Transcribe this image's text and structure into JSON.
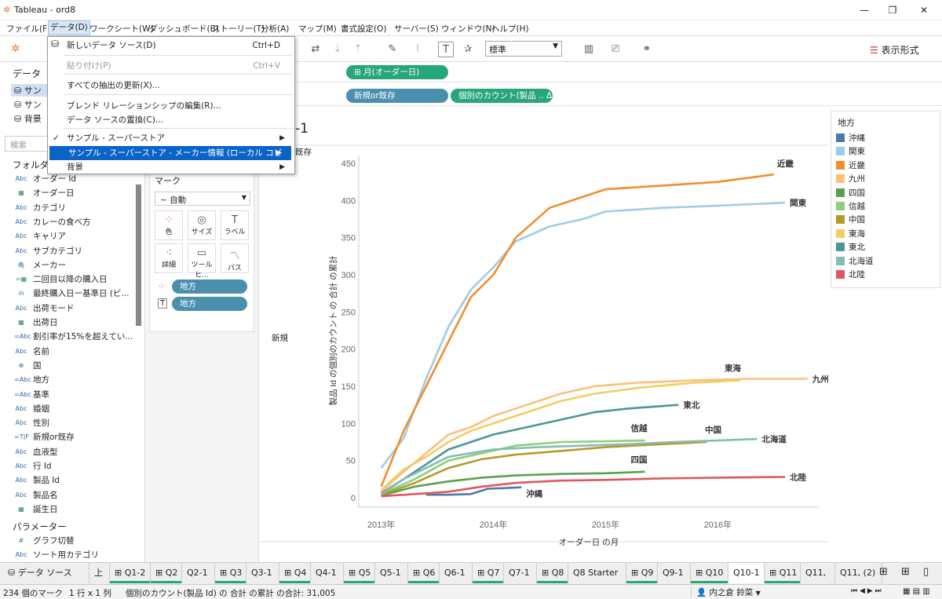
{
  "window": {
    "title": "Tableau - ord8"
  },
  "menu": [
    "ファイル(F)",
    "データ(D)",
    "ワークシート(W)",
    "ダッシュボード(B)",
    "ストーリー(T)",
    "分析(A)",
    "マップ(M)",
    "書式設定(O)",
    "サーバー(S)",
    "ウィンドウ(N)",
    "ヘルプ(H)"
  ],
  "toolbar": {
    "fit_select": "標準",
    "show_me": "表示形式"
  },
  "left": {
    "header": "データ",
    "sources": [
      "サンプル - スーパーストア",
      "サンプル - スーパーストア - メーカー情報 (ローカル コピー)",
      "背景"
    ],
    "sources_display": [
      "サン",
      "サン",
      "背景"
    ],
    "search_placeholder": "検索",
    "folders_label": "フォルダー",
    "fields": [
      {
        "icon": "Abc",
        "name": "オーダー Id"
      },
      {
        "icon": "cal",
        "name": "オーダー日"
      },
      {
        "icon": "Abc",
        "name": "カテゴリ"
      },
      {
        "icon": "Abc",
        "name": "カレーの食べ方"
      },
      {
        "icon": "Abc",
        "name": "キャリア"
      },
      {
        "icon": "Abc",
        "name": "サブカテゴリ"
      },
      {
        "icon": "clip",
        "name": "メーカー"
      },
      {
        "icon": "=cal",
        "name": "二回目以降の購入日"
      },
      {
        "icon": "bar",
        "name": "最終購入日ー基準日 (ビ..."
      },
      {
        "icon": "Abc",
        "name": "出荷モード"
      },
      {
        "icon": "cal",
        "name": "出荷日"
      },
      {
        "icon": "=Abc",
        "name": "割引率が15%を超えてい..."
      },
      {
        "icon": "Abc",
        "name": "名前"
      },
      {
        "icon": "globe",
        "name": "国"
      },
      {
        "icon": "=Abc",
        "name": "地方"
      },
      {
        "icon": "=Abc",
        "name": "基準"
      },
      {
        "icon": "Abc",
        "name": "婚姻"
      },
      {
        "icon": "Abc",
        "name": "性別"
      },
      {
        "icon": "=T|F",
        "name": "新規or既存"
      },
      {
        "icon": "Abc",
        "name": "血液型"
      },
      {
        "icon": "Abc",
        "name": "行 Id"
      },
      {
        "icon": "Abc",
        "name": "製品 Id"
      },
      {
        "icon": "Abc",
        "name": "製品名"
      },
      {
        "icon": "cal",
        "name": "誕生日"
      }
    ],
    "params_label": "パラメーター",
    "params": [
      {
        "icon": "#",
        "name": "グラフ切替"
      },
      {
        "icon": "Abc",
        "name": "ソート用カテゴリ"
      }
    ]
  },
  "marks": {
    "label": "マーク",
    "type": "自動",
    "buttons": [
      "色",
      "サイズ",
      "ラベル",
      "詳細",
      "ツールヒ...",
      "パス"
    ],
    "pills": [
      "地方",
      "地方"
    ]
  },
  "shelves": {
    "columns_pill": "⊞ 月(オーダー日)",
    "rows_pills": [
      "新規or既存",
      "個別のカウント(製品 .. Δ"
    ]
  },
  "viz": {
    "title_fragment": "-1",
    "header": "既存",
    "row_label": "新規"
  },
  "legend": {
    "title": "地方"
  },
  "dropdown": {
    "items": [
      {
        "label": "新しいデータ ソース(D)",
        "key": "Ctrl+D"
      },
      {
        "label": "貼り付け(P)",
        "key": "Ctrl+V",
        "disabled": true
      },
      {
        "label": "すべての抽出の更新(X)..."
      },
      {
        "label": "ブレンド リレーションシップの編集(R)..."
      },
      {
        "label": "データ ソースの置換(C)..."
      },
      {
        "label": "サンプル - スーパーストア",
        "checked": true,
        "sub": true
      },
      {
        "label": "サンプル - スーパーストア - メーカー情報 (ローカル コピー)",
        "sub": true,
        "highlight": true
      },
      {
        "label": "背景",
        "sub": true
      }
    ]
  },
  "tabs": [
    {
      "label": "データ ソース",
      "icon": "db"
    },
    {
      "label": "上",
      "partial": true
    },
    {
      "label": "⊞ Q1-2"
    },
    {
      "label": "⊞ Q2"
    },
    {
      "label": "Q2-1"
    },
    {
      "label": "⊞ Q3"
    },
    {
      "label": "Q3-1"
    },
    {
      "label": "⊞ Q4"
    },
    {
      "label": "Q4-1"
    },
    {
      "label": "⊞ Q5"
    },
    {
      "label": "Q5-1"
    },
    {
      "label": "⊞ Q6"
    },
    {
      "label": "Q6-1"
    },
    {
      "label": "⊞ Q7"
    },
    {
      "label": "Q7-1"
    },
    {
      "label": "⊞ Q8"
    },
    {
      "label": "Q8 Starter"
    },
    {
      "label": "⊞ Q9"
    },
    {
      "label": "Q9-1"
    },
    {
      "label": "⊞ Q10"
    },
    {
      "label": "Q10-1",
      "active": true
    },
    {
      "label": "⊞ Q11"
    },
    {
      "label": "Q11,"
    },
    {
      "label": "Q11, (2)"
    }
  ],
  "status": {
    "marks": "234 個のマーク",
    "rows": "1 行 x 1 列",
    "summary": "個別のカウント(製品 Id) の 合計 の累計 の合計: 31,005",
    "user": "内之倉 鈴菜"
  },
  "chart_data": {
    "type": "line",
    "xlabel": "オーダー日 の月",
    "ylabel": "製品 Id の個別のカウント の 合計 の累計",
    "x_ticks": [
      "2013年",
      "2014年",
      "2015年",
      "2016年"
    ],
    "ylim": [
      0,
      450
    ],
    "y_ticks": [
      0,
      50,
      100,
      150,
      200,
      250,
      300,
      350,
      400,
      450
    ],
    "legend_title": "地方",
    "series": [
      {
        "name": "沖縄",
        "color": "#4e79a7",
        "values": [
          [
            2013.4,
            4
          ],
          [
            2013.6,
            4
          ],
          [
            2013.8,
            5
          ],
          [
            2013.95,
            12
          ],
          [
            2014.1,
            13
          ],
          [
            2014.25,
            14
          ]
        ]
      },
      {
        "name": "関東",
        "color": "#a0cbe8",
        "values": [
          [
            2013.0,
            40
          ],
          [
            2013.2,
            80
          ],
          [
            2013.4,
            160
          ],
          [
            2013.6,
            230
          ],
          [
            2013.8,
            280
          ],
          [
            2014.0,
            310
          ],
          [
            2014.2,
            345
          ],
          [
            2014.5,
            365
          ],
          [
            2014.8,
            375
          ],
          [
            2015.0,
            385
          ],
          [
            2015.5,
            390
          ],
          [
            2016.0,
            393
          ],
          [
            2016.6,
            397
          ]
        ]
      },
      {
        "name": "近畿",
        "color": "#f28e2b",
        "values": [
          [
            2013.0,
            15
          ],
          [
            2013.2,
            90
          ],
          [
            2013.4,
            150
          ],
          [
            2013.6,
            210
          ],
          [
            2013.8,
            270
          ],
          [
            2014.0,
            300
          ],
          [
            2014.2,
            350
          ],
          [
            2014.5,
            390
          ],
          [
            2014.8,
            405
          ],
          [
            2015.0,
            415
          ],
          [
            2015.5,
            420
          ],
          [
            2016.0,
            425
          ],
          [
            2016.5,
            435
          ]
        ]
      },
      {
        "name": "九州",
        "color": "#ffbe7d",
        "values": [
          [
            2013.0,
            8
          ],
          [
            2013.2,
            35
          ],
          [
            2013.4,
            60
          ],
          [
            2013.6,
            85
          ],
          [
            2013.8,
            95
          ],
          [
            2014.0,
            110
          ],
          [
            2014.3,
            125
          ],
          [
            2014.6,
            140
          ],
          [
            2014.9,
            150
          ],
          [
            2015.3,
            155
          ],
          [
            2015.8,
            158
          ],
          [
            2016.3,
            160
          ],
          [
            2016.8,
            160
          ]
        ]
      },
      {
        "name": "四国",
        "color": "#59a14f",
        "values": [
          [
            2013.0,
            3
          ],
          [
            2013.3,
            15
          ],
          [
            2013.6,
            22
          ],
          [
            2013.9,
            27
          ],
          [
            2014.2,
            30
          ],
          [
            2014.6,
            32
          ],
          [
            2015.0,
            33
          ],
          [
            2015.35,
            35
          ]
        ]
      },
      {
        "name": "信越",
        "color": "#8cd17d",
        "values": [
          [
            2013.0,
            5
          ],
          [
            2013.3,
            25
          ],
          [
            2013.6,
            50
          ],
          [
            2013.9,
            60
          ],
          [
            2014.2,
            70
          ],
          [
            2014.6,
            75
          ],
          [
            2015.0,
            76
          ],
          [
            2015.35,
            77
          ]
        ]
      },
      {
        "name": "中国",
        "color": "#b6992d",
        "values": [
          [
            2013.0,
            4
          ],
          [
            2013.3,
            20
          ],
          [
            2013.6,
            40
          ],
          [
            2013.9,
            52
          ],
          [
            2014.2,
            58
          ],
          [
            2014.6,
            63
          ],
          [
            2015.0,
            68
          ],
          [
            2015.5,
            72
          ],
          [
            2015.9,
            75
          ]
        ]
      },
      {
        "name": "東海",
        "color": "#f1ce63",
        "values": [
          [
            2013.0,
            10
          ],
          [
            2013.2,
            38
          ],
          [
            2013.4,
            55
          ],
          [
            2013.6,
            75
          ],
          [
            2013.8,
            90
          ],
          [
            2014.0,
            100
          ],
          [
            2014.3,
            115
          ],
          [
            2014.6,
            130
          ],
          [
            2014.9,
            140
          ],
          [
            2015.3,
            148
          ],
          [
            2015.8,
            155
          ],
          [
            2016.2,
            158
          ]
        ]
      },
      {
        "name": "東北",
        "color": "#499894",
        "values": [
          [
            2013.0,
            6
          ],
          [
            2013.2,
            25
          ],
          [
            2013.4,
            45
          ],
          [
            2013.6,
            65
          ],
          [
            2013.8,
            75
          ],
          [
            2014.0,
            85
          ],
          [
            2014.3,
            95
          ],
          [
            2014.6,
            105
          ],
          [
            2014.9,
            115
          ],
          [
            2015.2,
            120
          ],
          [
            2015.65,
            125
          ]
        ]
      },
      {
        "name": "北海道",
        "color": "#86bcb6",
        "values": [
          [
            2013.0,
            5
          ],
          [
            2013.2,
            25
          ],
          [
            2013.4,
            40
          ],
          [
            2013.6,
            55
          ],
          [
            2013.8,
            60
          ],
          [
            2014.0,
            65
          ],
          [
            2014.4,
            68
          ],
          [
            2014.8,
            70
          ],
          [
            2015.2,
            72
          ],
          [
            2015.6,
            75
          ],
          [
            2016.0,
            77
          ],
          [
            2016.35,
            79
          ]
        ]
      },
      {
        "name": "北陸",
        "color": "#e15759",
        "values": [
          [
            2013.0,
            2
          ],
          [
            2013.3,
            5
          ],
          [
            2013.6,
            8
          ],
          [
            2013.9,
            15
          ],
          [
            2014.2,
            20
          ],
          [
            2014.6,
            23
          ],
          [
            2015.0,
            24
          ],
          [
            2015.5,
            26
          ],
          [
            2016.0,
            27
          ],
          [
            2016.6,
            28
          ]
        ]
      }
    ]
  }
}
